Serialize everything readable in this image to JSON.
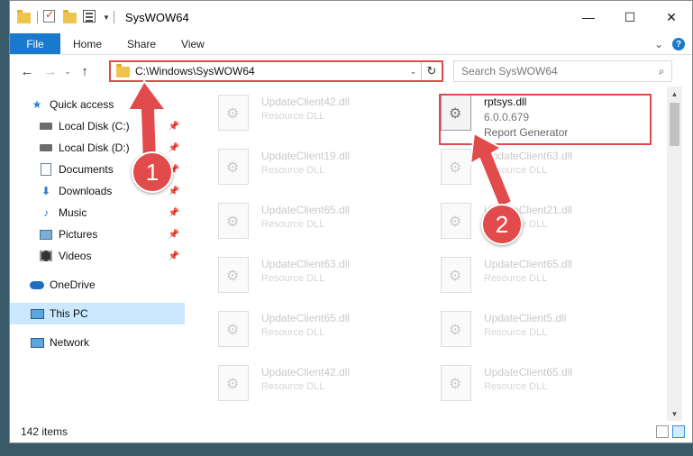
{
  "window": {
    "title": "SysWOW64"
  },
  "window_controls": {
    "minimize": "—",
    "maximize": "☐",
    "close": "✕"
  },
  "ribbon": {
    "tabs": [
      "File",
      "Home",
      "Share",
      "View"
    ],
    "expand": "⌄",
    "help": "?"
  },
  "nav": {
    "back": "←",
    "forward": "→",
    "recent": "⌄",
    "up": "↑"
  },
  "address": {
    "path": "C:\\Windows\\SysWOW64",
    "dropdown": "⌄",
    "refresh": "↻"
  },
  "search": {
    "placeholder": "Search SysWOW64",
    "icon": "⌕"
  },
  "sidebar": {
    "quick_access": "Quick access",
    "items": [
      {
        "label": "Local Disk (C:)",
        "icon": "drive-icon"
      },
      {
        "label": "Local Disk (D:)",
        "icon": "drive-icon"
      },
      {
        "label": "Documents",
        "icon": "documents-icon"
      },
      {
        "label": "Downloads",
        "icon": "downloads-icon"
      },
      {
        "label": "Music",
        "icon": "music-icon"
      },
      {
        "label": "Pictures",
        "icon": "pictures-icon"
      },
      {
        "label": "Videos",
        "icon": "videos-icon"
      }
    ],
    "onedrive": "OneDrive",
    "this_pc": "This PC",
    "network": "Network"
  },
  "files": {
    "col1": [
      {
        "name": "UpdateClient42.dll",
        "type": "Resource DLL"
      },
      {
        "name": "UpdateClient19.dll",
        "type": "Resource DLL"
      },
      {
        "name": "UpdateClient65.dll",
        "type": "Resource DLL"
      },
      {
        "name": "UpdateClient63.dll",
        "type": "Resource DLL"
      },
      {
        "name": "UpdateClient65.dll",
        "type": "Resource DLL"
      },
      {
        "name": "UpdateClient42.dll",
        "type": "Resource DLL"
      }
    ],
    "col2": [
      {
        "name": "rptsys.dll",
        "version": "6.0.0.679",
        "type": "Report Generator"
      },
      {
        "name": "UpdateClient63.dll",
        "type": "Resource DLL"
      },
      {
        "name": "UpdateClient21.dll",
        "type": "Resource DLL"
      },
      {
        "name": "UpdateClient65.dll",
        "type": "Resource DLL"
      },
      {
        "name": "UpdateClient5.dll",
        "type": "Resource DLL"
      },
      {
        "name": "UpdateClient65.dll",
        "type": "Resource DLL"
      }
    ]
  },
  "status": {
    "item_count": "142 items"
  },
  "annotations": {
    "marker1": "1",
    "marker2": "2",
    "color": "#e24b4b"
  }
}
